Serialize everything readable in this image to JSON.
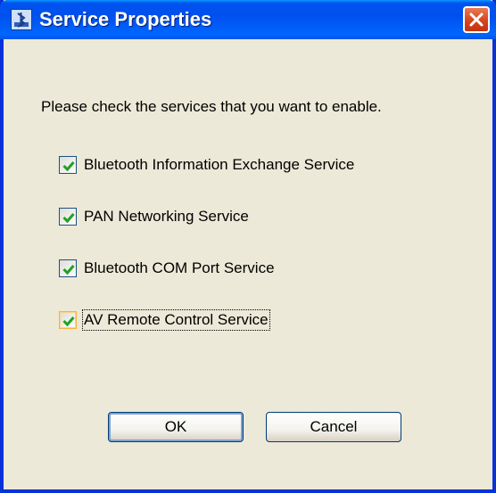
{
  "window": {
    "title": "Service Properties"
  },
  "prompt": "Please check the services that you want to enable.",
  "options": [
    {
      "label": "Bluetooth Information Exchange Service",
      "checked": true
    },
    {
      "label": "PAN Networking Service",
      "checked": true
    },
    {
      "label": "Bluetooth COM Port Service",
      "checked": true
    },
    {
      "label": "AV Remote Control Service",
      "checked": true,
      "focused": true
    }
  ],
  "buttons": {
    "ok": "OK",
    "cancel": "Cancel"
  },
  "icons": {
    "title": "bluetooth-app-icon",
    "close": "close-icon",
    "check": "checkmark-icon"
  },
  "colors": {
    "titlebar": "#0054E3",
    "close": "#D6451E",
    "check": "#21A121",
    "face": "#ECE9D8"
  }
}
